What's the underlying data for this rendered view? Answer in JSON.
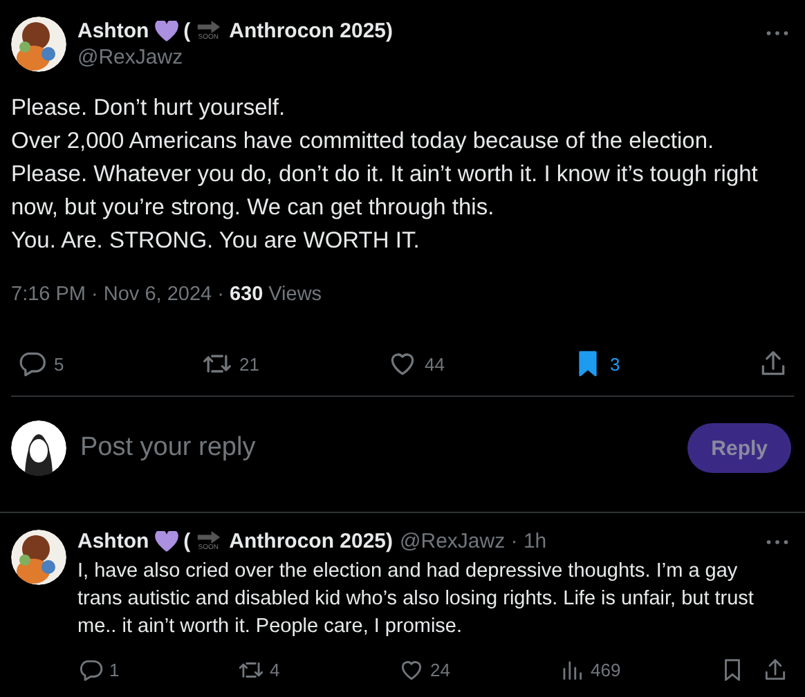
{
  "post": {
    "author": {
      "name": "Ashton",
      "open_paren": "(",
      "emoji_label": "SOON",
      "name_tail": "Anthrocon 2025)",
      "handle": "@RexJawz"
    },
    "paragraphs": [
      "Please. Don’t hurt yourself.",
      "Over 2,000 Americans have committed today because of the election.",
      "Please. Whatever you do, don’t do it. It ain’t worth it. I know it’s tough right now, but you’re strong. We can get through this.",
      "You. Are. STRONG. You are WORTH IT."
    ],
    "time": "7:16 PM · Nov 6, 2024 ·",
    "views_count": "630",
    "views_label": "Views",
    "actions": [
      {
        "kind": "reply",
        "count": "5",
        "selected": false
      },
      {
        "kind": "repost",
        "count": "21",
        "selected": false
      },
      {
        "kind": "like",
        "count": "44",
        "selected": false
      },
      {
        "kind": "bookmark",
        "count": "3",
        "selected": true
      },
      {
        "kind": "share"
      }
    ]
  },
  "composer": {
    "placeholder": "Post your reply",
    "button": "Reply",
    "disabled": true
  },
  "reply": {
    "author": {
      "name": "Ashton",
      "open_paren": "(",
      "emoji_label": "SOON",
      "name_tail": "Anthrocon 2025)",
      "meta": "@RexJawz · 1h"
    },
    "text": "I, have also cried over the election and had depressive thoughts. I’m a gay trans autistic and disabled kid who’s also losing rights. Life is unfair, but trust me.. it ain’t worth it. People care, I promise.",
    "actions": [
      {
        "kind": "reply",
        "count": "1",
        "selected": false
      },
      {
        "kind": "repost",
        "count": "4",
        "selected": false
      },
      {
        "kind": "like",
        "count": "24",
        "selected": false
      },
      {
        "kind": "views",
        "count": "469"
      },
      {
        "kind": "bookmark",
        "selected": false
      },
      {
        "kind": "share"
      }
    ]
  }
}
